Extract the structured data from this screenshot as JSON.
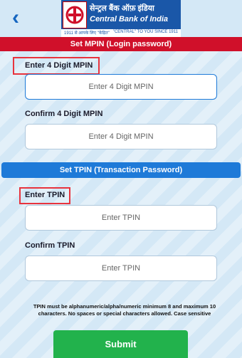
{
  "header": {
    "back_icon": "chevron-left-icon",
    "bank_name_hindi": "सेन्ट्रल बैंक ऑफ़ इंडिया",
    "bank_name": "Central Bank of India",
    "tagline_left": "1911 से आपके लिए \"केंद्रित\"",
    "tagline_right": "\"CENTRAL\" TO YOU SINCE 1911"
  },
  "mpin_section": {
    "title": "Set MPIN (Login password)",
    "enter_label": "Enter 4 Digit MPIN",
    "enter_placeholder": "Enter 4 Digit MPIN",
    "confirm_label": "Confirm 4 Digit MPIN",
    "confirm_placeholder": "Enter 4 Digit MPIN"
  },
  "tpin_section": {
    "title": "Set TPIN (Transaction Password)",
    "enter_label": "Enter TPIN",
    "enter_placeholder": "Enter TPIN",
    "confirm_label": "Confirm TPIN",
    "confirm_placeholder": "Enter TPIN"
  },
  "note": "TPIN must be alphanumeric/alpha/numeric minimum 8 and maximum 10 characters. No spaces or special characters allowed. Case sensitive",
  "submit_label": "Submit",
  "colors": {
    "header_bar": "#d0102a",
    "section_bar": "#1e7ad8",
    "submit": "#22b24c",
    "highlight": "#e8333d",
    "brand_blue": "#1a57a8"
  }
}
